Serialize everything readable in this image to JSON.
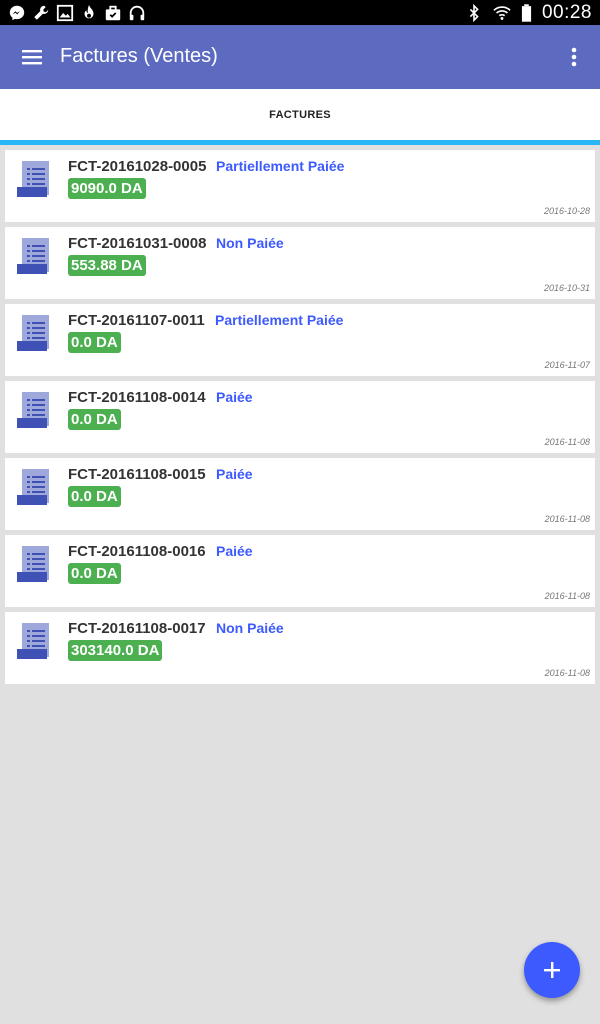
{
  "status_bar": {
    "time": "00:28",
    "left_icons": [
      "messenger-icon",
      "wrench-icon",
      "image-icon",
      "flame-icon",
      "briefcase-icon",
      "headphones-icon"
    ],
    "right_icons": [
      "bluetooth-icon",
      "wifi-icon",
      "battery-icon"
    ]
  },
  "app_bar": {
    "title": "Factures (Ventes)",
    "menu_icon": "hamburger-menu-icon",
    "overflow_icon": "more-vert-icon",
    "color": "#5c6bc0"
  },
  "tabs": [
    {
      "label": "FACTURES",
      "active": true,
      "indicator_color": "#29b6f6"
    }
  ],
  "invoices": [
    {
      "code": "FCT-20161028-0005",
      "status": "Partiellement Paiée",
      "amount": "9090.0 DA",
      "date": "2016-10-28"
    },
    {
      "code": "FCT-20161031-0008",
      "status": "Non Paiée",
      "amount": "553.88 DA",
      "date": "2016-10-31"
    },
    {
      "code": "FCT-20161107-0011",
      "status": "Partiellement Paiée",
      "amount": "0.0 DA",
      "date": "2016-11-07"
    },
    {
      "code": "FCT-20161108-0014",
      "status": "Paiée",
      "amount": "0.0 DA",
      "date": "2016-11-08"
    },
    {
      "code": "FCT-20161108-0015",
      "status": "Paiée",
      "amount": "0.0 DA",
      "date": "2016-11-08"
    },
    {
      "code": "FCT-20161108-0016",
      "status": "Paiée",
      "amount": "0.0 DA",
      "date": "2016-11-08"
    },
    {
      "code": "FCT-20161108-0017",
      "status": "Non Paiée",
      "amount": "303140.0 DA",
      "date": "2016-11-08"
    }
  ],
  "fab": {
    "icon": "plus-icon",
    "color": "#3d5afe"
  },
  "colors": {
    "amount_badge": "#4caf50",
    "status_text": "#3d5afe",
    "doc_icon": "#5c6bc0"
  }
}
